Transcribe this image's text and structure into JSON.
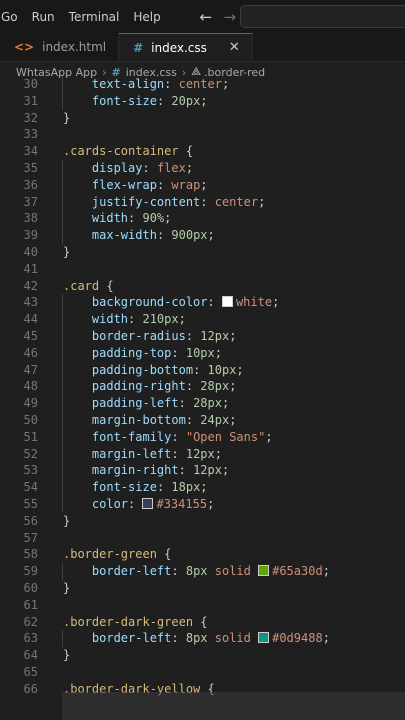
{
  "menu": {
    "items": [
      "Go",
      "Run",
      "Terminal",
      "Help"
    ],
    "back_icon": "arrow-left-icon",
    "forward_icon": "arrow-right-icon"
  },
  "tabs": [
    {
      "label": "index.html",
      "icon": "html-file-icon",
      "active": false
    },
    {
      "label": "index.css",
      "icon": "css-file-icon",
      "active": true,
      "close": "✕"
    }
  ],
  "breadcrumb": {
    "folder": "WhtasApp App",
    "file": "index.css",
    "symbol": ".border-red"
  },
  "code": {
    "lines": [
      {
        "n": "30",
        "tokens": [
          [
            "    ",
            ""
          ],
          [
            "text-align",
            "prop"
          ],
          [
            ": ",
            "punc"
          ],
          [
            "center",
            "str"
          ],
          [
            ";",
            "punc"
          ]
        ]
      },
      {
        "n": "31",
        "tokens": [
          [
            "    ",
            ""
          ],
          [
            "font-size",
            "prop"
          ],
          [
            ": ",
            "punc"
          ],
          [
            "20px",
            "num"
          ],
          [
            ";",
            "punc"
          ]
        ]
      },
      {
        "n": "32",
        "tokens": [
          [
            "}",
            "punc"
          ]
        ]
      },
      {
        "n": "33",
        "tokens": []
      },
      {
        "n": "34",
        "tokens": [
          [
            ".cards-container",
            "sel"
          ],
          [
            " {",
            "punc"
          ]
        ]
      },
      {
        "n": "35",
        "tokens": [
          [
            "    ",
            ""
          ],
          [
            "display",
            "prop"
          ],
          [
            ": ",
            "punc"
          ],
          [
            "flex",
            "str"
          ],
          [
            ";",
            "punc"
          ]
        ]
      },
      {
        "n": "36",
        "tokens": [
          [
            "    ",
            ""
          ],
          [
            "flex-wrap",
            "prop"
          ],
          [
            ": ",
            "punc"
          ],
          [
            "wrap",
            "str"
          ],
          [
            ";",
            "punc"
          ]
        ]
      },
      {
        "n": "37",
        "tokens": [
          [
            "    ",
            ""
          ],
          [
            "justify-content",
            "prop"
          ],
          [
            ": ",
            "punc"
          ],
          [
            "center",
            "str"
          ],
          [
            ";",
            "punc"
          ]
        ]
      },
      {
        "n": "38",
        "tokens": [
          [
            "    ",
            ""
          ],
          [
            "width",
            "prop"
          ],
          [
            ": ",
            "punc"
          ],
          [
            "90%",
            "num"
          ],
          [
            ";",
            "punc"
          ]
        ]
      },
      {
        "n": "39",
        "tokens": [
          [
            "    ",
            ""
          ],
          [
            "max-width",
            "prop"
          ],
          [
            ": ",
            "punc"
          ],
          [
            "900px",
            "num"
          ],
          [
            ";",
            "punc"
          ]
        ]
      },
      {
        "n": "40",
        "tokens": [
          [
            "}",
            "punc"
          ]
        ]
      },
      {
        "n": "41",
        "tokens": []
      },
      {
        "n": "42",
        "tokens": [
          [
            ".card",
            "sel"
          ],
          [
            " {",
            "punc"
          ]
        ]
      },
      {
        "n": "43",
        "tokens": [
          [
            "    ",
            ""
          ],
          [
            "background-color",
            "prop"
          ],
          [
            ": ",
            "punc"
          ],
          [
            "#ffffff",
            "swatch"
          ],
          [
            "white",
            "str"
          ],
          [
            ";",
            "punc"
          ]
        ]
      },
      {
        "n": "44",
        "tokens": [
          [
            "    ",
            ""
          ],
          [
            "width",
            "prop"
          ],
          [
            ": ",
            "punc"
          ],
          [
            "210px",
            "num"
          ],
          [
            ";",
            "punc"
          ]
        ]
      },
      {
        "n": "45",
        "tokens": [
          [
            "    ",
            ""
          ],
          [
            "border-radius",
            "prop"
          ],
          [
            ": ",
            "punc"
          ],
          [
            "12px",
            "num"
          ],
          [
            ";",
            "punc"
          ]
        ]
      },
      {
        "n": "46",
        "tokens": [
          [
            "    ",
            ""
          ],
          [
            "padding-top",
            "prop"
          ],
          [
            ": ",
            "punc"
          ],
          [
            "10px",
            "num"
          ],
          [
            ";",
            "punc"
          ]
        ]
      },
      {
        "n": "47",
        "tokens": [
          [
            "    ",
            ""
          ],
          [
            "padding-bottom",
            "prop"
          ],
          [
            ": ",
            "punc"
          ],
          [
            "10px",
            "num"
          ],
          [
            ";",
            "punc"
          ]
        ]
      },
      {
        "n": "48",
        "tokens": [
          [
            "    ",
            ""
          ],
          [
            "padding-right",
            "prop"
          ],
          [
            ": ",
            "punc"
          ],
          [
            "28px",
            "num"
          ],
          [
            ";",
            "punc"
          ]
        ]
      },
      {
        "n": "49",
        "tokens": [
          [
            "    ",
            ""
          ],
          [
            "padding-left",
            "prop"
          ],
          [
            ": ",
            "punc"
          ],
          [
            "28px",
            "num"
          ],
          [
            ";",
            "punc"
          ]
        ]
      },
      {
        "n": "50",
        "tokens": [
          [
            "    ",
            ""
          ],
          [
            "margin-bottom",
            "prop"
          ],
          [
            ": ",
            "punc"
          ],
          [
            "24px",
            "num"
          ],
          [
            ";",
            "punc"
          ]
        ]
      },
      {
        "n": "51",
        "tokens": [
          [
            "    ",
            ""
          ],
          [
            "font-family",
            "prop"
          ],
          [
            ": ",
            "punc"
          ],
          [
            "\"Open Sans\"",
            "str"
          ],
          [
            ";",
            "punc"
          ]
        ]
      },
      {
        "n": "52",
        "tokens": [
          [
            "    ",
            ""
          ],
          [
            "margin-left",
            "prop"
          ],
          [
            ": ",
            "punc"
          ],
          [
            "12px",
            "num"
          ],
          [
            ";",
            "punc"
          ]
        ]
      },
      {
        "n": "53",
        "tokens": [
          [
            "    ",
            ""
          ],
          [
            "margin-right",
            "prop"
          ],
          [
            ": ",
            "punc"
          ],
          [
            "12px",
            "num"
          ],
          [
            ";",
            "punc"
          ]
        ]
      },
      {
        "n": "54",
        "tokens": [
          [
            "    ",
            ""
          ],
          [
            "font-size",
            "prop"
          ],
          [
            ": ",
            "punc"
          ],
          [
            "18px",
            "num"
          ],
          [
            ";",
            "punc"
          ]
        ]
      },
      {
        "n": "55",
        "tokens": [
          [
            "    ",
            ""
          ],
          [
            "color",
            "prop"
          ],
          [
            ": ",
            "punc"
          ],
          [
            "#334155",
            "swatch"
          ],
          [
            "#334155",
            "str"
          ],
          [
            ";",
            "punc"
          ]
        ]
      },
      {
        "n": "56",
        "tokens": [
          [
            "}",
            "punc"
          ]
        ]
      },
      {
        "n": "57",
        "tokens": []
      },
      {
        "n": "58",
        "tokens": [
          [
            ".border-green",
            "sel"
          ],
          [
            " {",
            "punc"
          ]
        ]
      },
      {
        "n": "59",
        "tokens": [
          [
            "    ",
            ""
          ],
          [
            "border-left",
            "prop"
          ],
          [
            ": ",
            "punc"
          ],
          [
            "8px",
            "num"
          ],
          [
            " solid ",
            "str"
          ],
          [
            "#65a30d",
            "swatch"
          ],
          [
            "#65a30d",
            "str"
          ],
          [
            ";",
            "punc"
          ]
        ]
      },
      {
        "n": "60",
        "tokens": [
          [
            "}",
            "punc"
          ]
        ]
      },
      {
        "n": "61",
        "tokens": []
      },
      {
        "n": "62",
        "tokens": [
          [
            ".border-dark-green",
            "sel"
          ],
          [
            " {",
            "punc"
          ]
        ]
      },
      {
        "n": "63",
        "tokens": [
          [
            "    ",
            ""
          ],
          [
            "border-left",
            "prop"
          ],
          [
            ": ",
            "punc"
          ],
          [
            "8px",
            "num"
          ],
          [
            " solid ",
            "str"
          ],
          [
            "#0d9488",
            "swatch"
          ],
          [
            "#0d9488",
            "str"
          ],
          [
            ";",
            "punc"
          ]
        ]
      },
      {
        "n": "64",
        "tokens": [
          [
            "}",
            "punc"
          ]
        ]
      },
      {
        "n": "65",
        "tokens": []
      },
      {
        "n": "66",
        "tokens": [
          [
            ".border-dark-yellow",
            "sel"
          ],
          [
            " {",
            "punc"
          ]
        ]
      }
    ]
  },
  "colors": {
    "selector": "#d7ba7d",
    "property": "#9cdcfe",
    "number": "#b5cea8",
    "string": "#ce9178",
    "accent": "#0078d4"
  }
}
